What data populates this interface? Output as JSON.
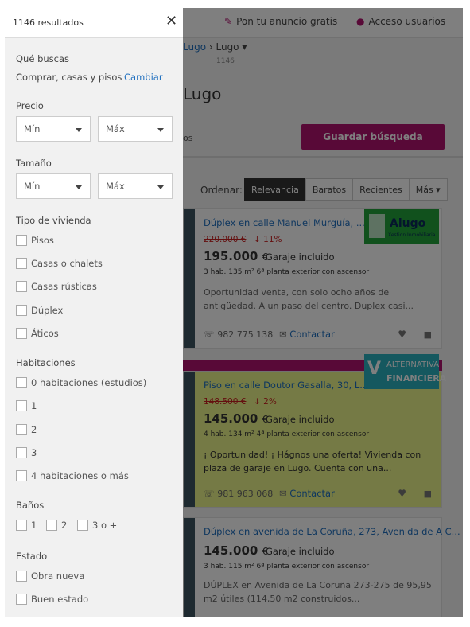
{
  "topbar": {
    "publish": "Pon tu anuncio gratis",
    "access": "Acceso usuarios"
  },
  "breadcrumb": {
    "parent": "Lugo",
    "current": "Lugo",
    "count": "1146"
  },
  "page_title": "Lugo",
  "save_search": "Guardar búsqueda",
  "partial_text": "os",
  "sort": {
    "label": "Ordenar:",
    "options": [
      "Relevancia",
      "Baratos",
      "Recientes",
      "Más"
    ]
  },
  "listings": [
    {
      "title": "Dúplex en calle Manuel Murguía, ...",
      "old_price": "220.000 €",
      "drop": "↓ 11%",
      "price": "195.000",
      "currency": "€",
      "extra": "Garaje incluido",
      "features": "3 hab.  135 m²  6ª planta exterior con ascensor",
      "desc": "Oportunidad venta, con solo ocho años de antigüedad. A un paso del centro. Duplex casi...",
      "phone": "982 775 138",
      "contact": "Contactar",
      "logo_text": "Alugo",
      "logo_sub": "Xestion Inmobiliaria",
      "highlight": "#ffffff",
      "accent": "#22a33a"
    },
    {
      "title": "Piso en calle Doutor Gasalla, 30, L...",
      "old_price": "148.500 €",
      "drop": "↓ 2%",
      "price": "145.000",
      "currency": "€",
      "extra": "Garaje incluido",
      "features": "4 hab.  134 m²  4ª planta exterior con ascensor",
      "desc": "¡ Oportunidad! ¡ Hágnos una oferta! Vivienda con plaza de garaje en Lugo. Cuenta con una...",
      "phone": "981 963 068",
      "contact": "Contactar",
      "logo_text": "ALTERNATIVA",
      "logo_sub": "FINANCIERA",
      "highlight": "#eaf58a",
      "accent": "#2bb0bf"
    },
    {
      "title": "Dúplex en avenida de La Coruña, 273, Avenida de A C...",
      "price": "145.000",
      "currency": "€",
      "extra": "Garaje incluido",
      "features": "3 hab.  115 m²  6ª planta exterior con ascensor",
      "desc": "DÚPLEX en Avenida de La Coruña 273-275 de 95,95 m2 útiles (114,50 m2 construidos..."
    }
  ],
  "filters": {
    "count": "1146 resultados",
    "what_label": "Qué buscas",
    "what_value": "Comprar, casas y pisos",
    "change": "Cambiar",
    "price_label": "Precio",
    "size_label": "Tamaño",
    "min": "Mín",
    "max": "Máx",
    "type_label": "Tipo de vivienda",
    "types": [
      "Pisos",
      "Casas o chalets",
      "Casas rústicas",
      "Dúplex",
      "Áticos"
    ],
    "rooms_label": "Habitaciones",
    "rooms": [
      "0 habitaciones (estudios)",
      "1",
      "2",
      "3",
      "4 habitaciones o más"
    ],
    "baths_label": "Baños",
    "baths": [
      "1",
      "2",
      "3 o +"
    ],
    "state_label": "Estado",
    "states": [
      "Obra nueva",
      "Buen estado"
    ]
  },
  "colors": {
    "brand": "#b0136f",
    "link": "#1f6fbf",
    "drop": "#c81e1e"
  }
}
